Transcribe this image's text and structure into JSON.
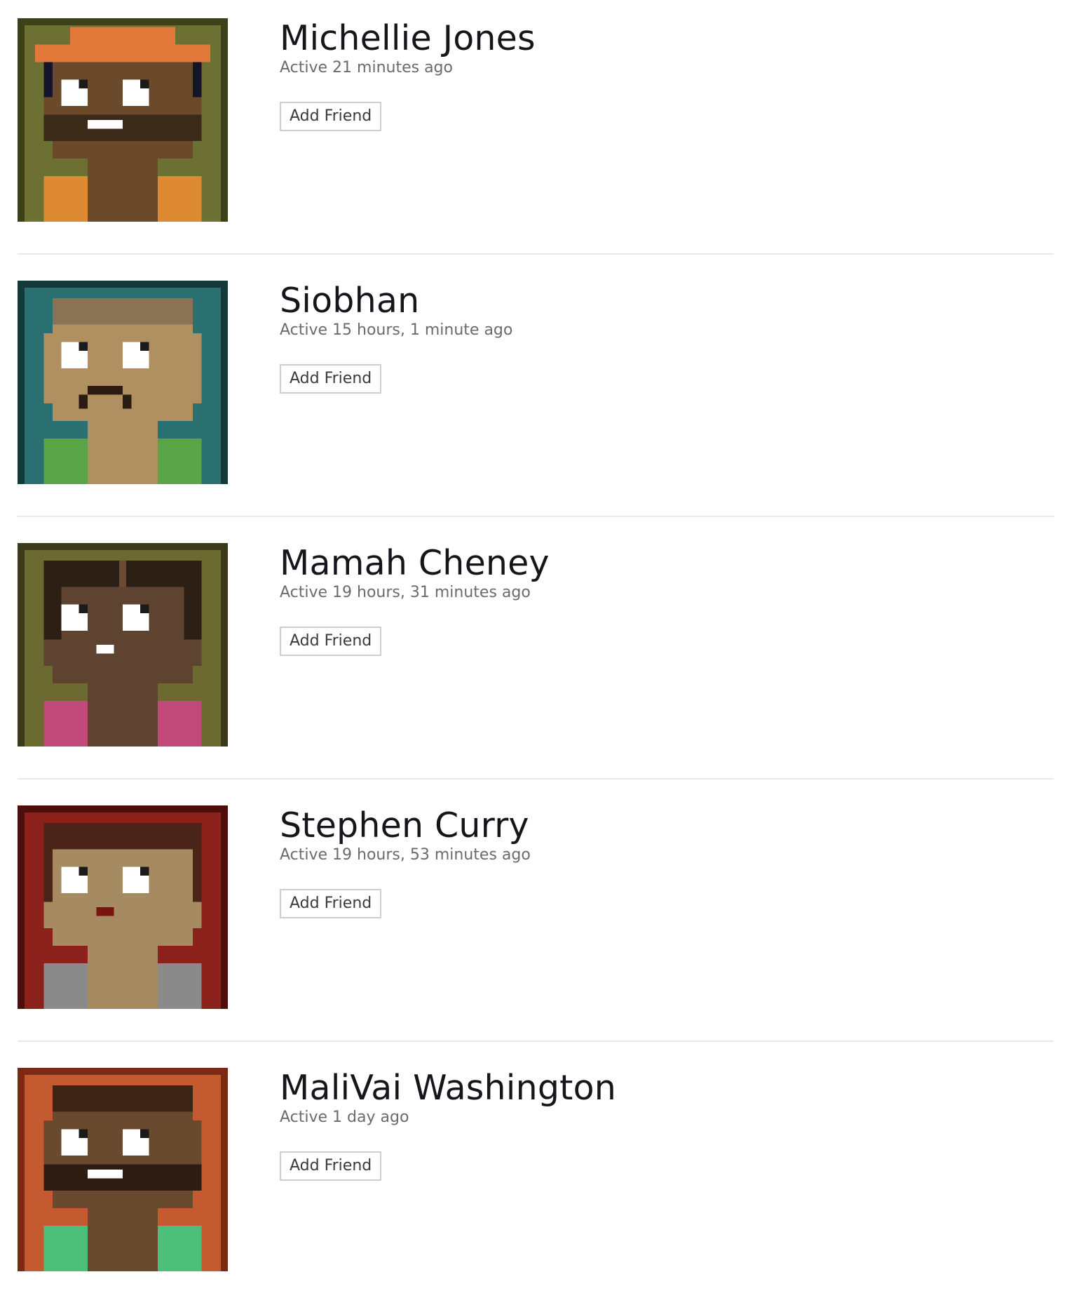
{
  "friends": [
    {
      "name": "Michellie Jones",
      "status": "Active 21 minutes ago",
      "button_label": "Add Friend",
      "avatar": {
        "bg": "#6d7033",
        "bg_edge": "#3e4019",
        "skin": "#6b4a2c",
        "hair": "#e2793a",
        "shirt": "#de8a32",
        "mouth": "#ffffff",
        "beard": "#3c2a19",
        "hat": true,
        "beard_full": true,
        "sideburn": "#14142a"
      }
    },
    {
      "name": "Siobhan",
      "status": "Active 15 hours, 1 minute ago",
      "button_label": "Add Friend",
      "avatar": {
        "bg": "#2b7071",
        "bg_edge": "#13393a",
        "skin": "#b08f61",
        "hair": "#8a7354",
        "shirt": "#5aa346",
        "mouth": "#2a1c12",
        "beard": "#2a1c12",
        "hat": false,
        "mustache": true
      }
    },
    {
      "name": "Mamah Cheney",
      "status": "Active 19 hours, 31 minutes ago",
      "button_label": "Add Friend",
      "avatar": {
        "bg": "#6b6a31",
        "bg_edge": "#3a3a18",
        "skin": "#5e4330",
        "hair": "#2b1f16",
        "shirt": "#c24a7b",
        "mouth": "#ffffff",
        "beard": "#2b1f16",
        "hat": false,
        "mamah": true
      }
    },
    {
      "name": "Stephen Curry",
      "status": "Active 19 hours, 53 minutes ago",
      "button_label": "Add Friend",
      "avatar": {
        "bg": "#8c201b",
        "bg_edge": "#4d0f0c",
        "skin": "#a58a62",
        "hair": "#4a2418",
        "shirt": "#8a8a8a",
        "mouth": "#7a1410",
        "beard": "#4a2418",
        "hat": false,
        "curry": true
      }
    },
    {
      "name": "MaliVai Washington",
      "status": "Active 1 day ago",
      "button_label": "Add Friend",
      "avatar": {
        "bg": "#c45a30",
        "bg_edge": "#7a2a12",
        "skin": "#6a4a2e",
        "hair": "#3c2416",
        "shirt": "#4cc07a",
        "mouth": "#ffffff",
        "beard": "#2e1d12",
        "hat": false,
        "beard_full": true
      }
    }
  ]
}
